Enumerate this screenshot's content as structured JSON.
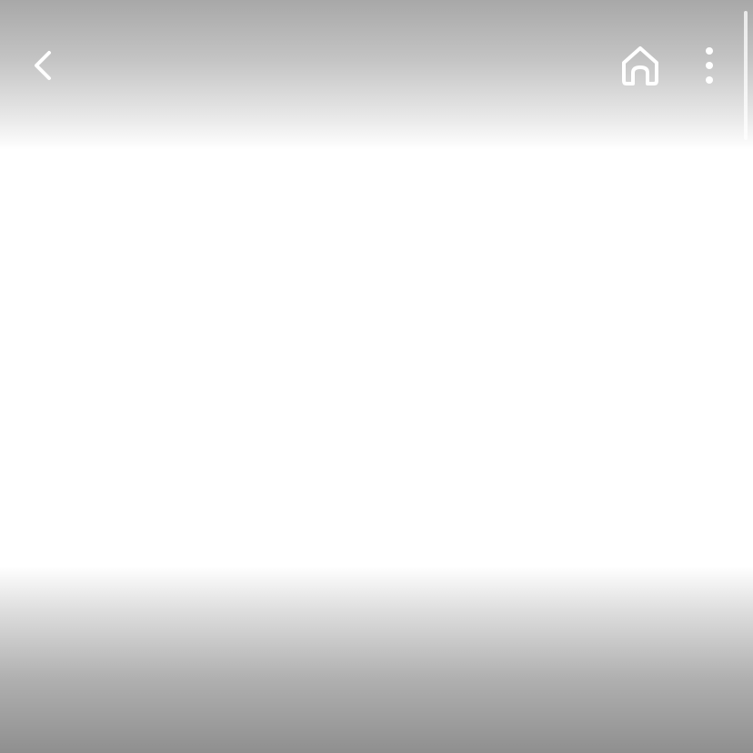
{
  "toolbar": {
    "back_icon": "chevron-left-icon",
    "home_icon": "home-icon",
    "more_icon": "more-vertical-icon",
    "icon_color": "#ffffff"
  },
  "colors": {
    "shade_top": "#a8a8a8",
    "shade_bottom": "#8f8f8f",
    "background": "#ffffff"
  }
}
